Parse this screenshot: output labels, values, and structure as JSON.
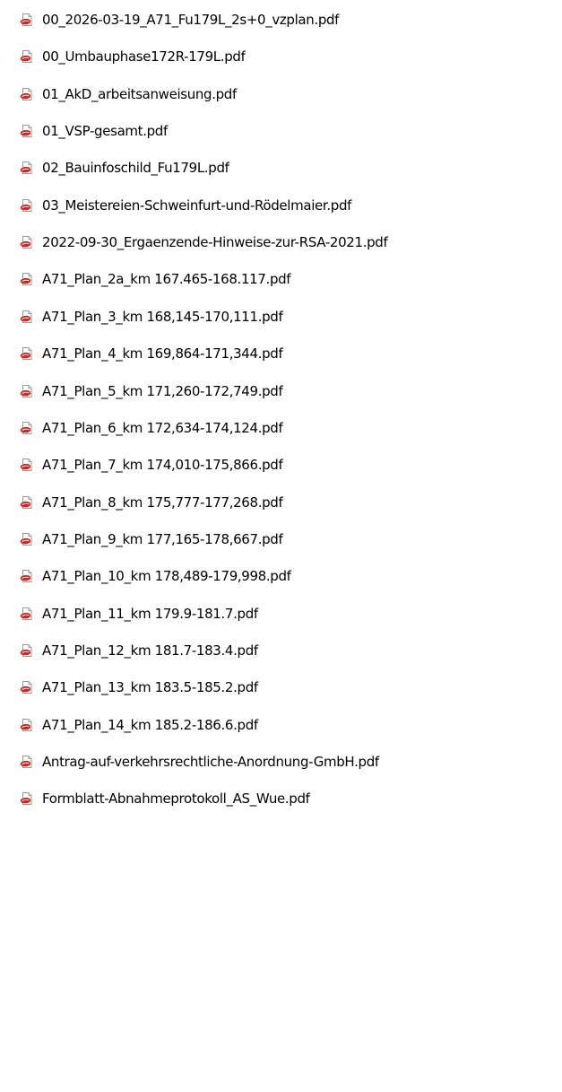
{
  "colors": {
    "text": "#000000",
    "background": "#ffffff",
    "pdf_icon_red": "#d9221c",
    "pdf_icon_paper": "#ffffff"
  },
  "files": [
    {
      "name": "00_2026-03-19_A71_Fu179L_2s+0_vzplan.pdf",
      "icon": "pdf-file-icon"
    },
    {
      "name": "00_Umbauphase172R-179L.pdf",
      "icon": "pdf-file-icon"
    },
    {
      "name": "01_AkD_arbeitsanweisung.pdf",
      "icon": "pdf-file-icon"
    },
    {
      "name": "01_VSP-gesamt.pdf",
      "icon": "pdf-file-icon"
    },
    {
      "name": "02_Bauinfoschild_Fu179L.pdf",
      "icon": "pdf-file-icon"
    },
    {
      "name": "03_Meistereien-Schweinfurt-und-Rödelmaier.pdf",
      "icon": "pdf-file-icon"
    },
    {
      "name": "2022-09-30_Ergaenzende-Hinweise-zur-RSA-2021.pdf",
      "icon": "pdf-file-icon"
    },
    {
      "name": "A71_Plan_2a_km 167.465-168.117.pdf",
      "icon": "pdf-file-icon"
    },
    {
      "name": "A71_Plan_3_km 168,145-170,111.pdf",
      "icon": "pdf-file-icon"
    },
    {
      "name": "A71_Plan_4_km 169,864-171,344.pdf",
      "icon": "pdf-file-icon"
    },
    {
      "name": "A71_Plan_5_km 171,260-172,749.pdf",
      "icon": "pdf-file-icon"
    },
    {
      "name": "A71_Plan_6_km 172,634-174,124.pdf",
      "icon": "pdf-file-icon"
    },
    {
      "name": "A71_Plan_7_km 174,010-175,866.pdf",
      "icon": "pdf-file-icon"
    },
    {
      "name": "A71_Plan_8_km 175,777-177,268.pdf",
      "icon": "pdf-file-icon"
    },
    {
      "name": "A71_Plan_9_km 177,165-178,667.pdf",
      "icon": "pdf-file-icon"
    },
    {
      "name": "A71_Plan_10_km 178,489-179,998.pdf",
      "icon": "pdf-file-icon"
    },
    {
      "name": "A71_Plan_11_km 179.9-181.7.pdf",
      "icon": "pdf-file-icon"
    },
    {
      "name": "A71_Plan_12_km 181.7-183.4.pdf",
      "icon": "pdf-file-icon"
    },
    {
      "name": "A71_Plan_13_km 183.5-185.2.pdf",
      "icon": "pdf-file-icon"
    },
    {
      "name": "A71_Plan_14_km 185.2-186.6.pdf",
      "icon": "pdf-file-icon"
    },
    {
      "name": "Antrag-auf-verkehrsrechtliche-Anordnung-GmbH.pdf",
      "icon": "pdf-file-icon"
    },
    {
      "name": "Formblatt-Abnahmeprotokoll_AS_Wue.pdf",
      "icon": "pdf-file-icon"
    }
  ]
}
